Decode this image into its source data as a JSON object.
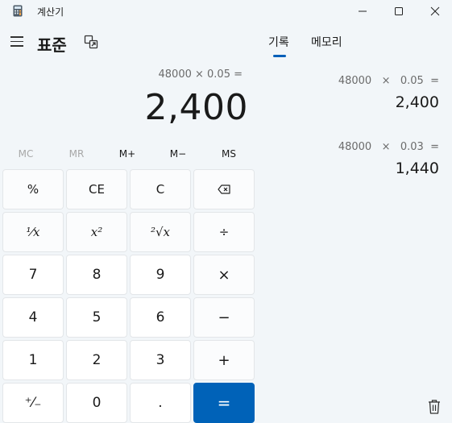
{
  "window": {
    "title": "계산기",
    "icon": "calculator-icon",
    "controls": [
      "minimize-icon",
      "maximize-icon",
      "close-icon"
    ]
  },
  "header": {
    "mode_title": "표준",
    "menu_icon": "hamburger-icon",
    "keep_on_top_icon": "keep-on-top-icon"
  },
  "tabs": [
    {
      "label": "기록",
      "active": true
    },
    {
      "label": "메모리",
      "active": false
    }
  ],
  "display": {
    "expression": "48000 × 0.05 =",
    "result": "2,400"
  },
  "memory": [
    {
      "label": "MC",
      "enabled": false
    },
    {
      "label": "MR",
      "enabled": false
    },
    {
      "label": "M+",
      "enabled": true
    },
    {
      "label": "M−",
      "enabled": true
    },
    {
      "label": "MS",
      "enabled": true
    }
  ],
  "keypad": {
    "percent": "%",
    "clear_entry": "CE",
    "clear": "C",
    "backspace_icon": "backspace-icon",
    "reciprocal": "¹⁄x",
    "square": "x²",
    "sqrt": "²√x",
    "divide": "÷",
    "seven": "7",
    "eight": "8",
    "nine": "9",
    "multiply": "×",
    "four": "4",
    "five": "5",
    "six": "6",
    "minus": "−",
    "one": "1",
    "two": "2",
    "three": "3",
    "plus": "+",
    "negate": "⁺⁄₋",
    "zero": "0",
    "decimal": ".",
    "equals": "="
  },
  "history": [
    {
      "expression": "48000   ×   0.05  =",
      "result": "2,400"
    },
    {
      "expression": "48000   ×   0.03  =",
      "result": "1,440"
    }
  ],
  "history_actions": {
    "delete_icon": "trash-icon"
  },
  "colors": {
    "accent": "#005fb8",
    "equals_bg": "#0062b8",
    "background": "#f2f6f9"
  }
}
